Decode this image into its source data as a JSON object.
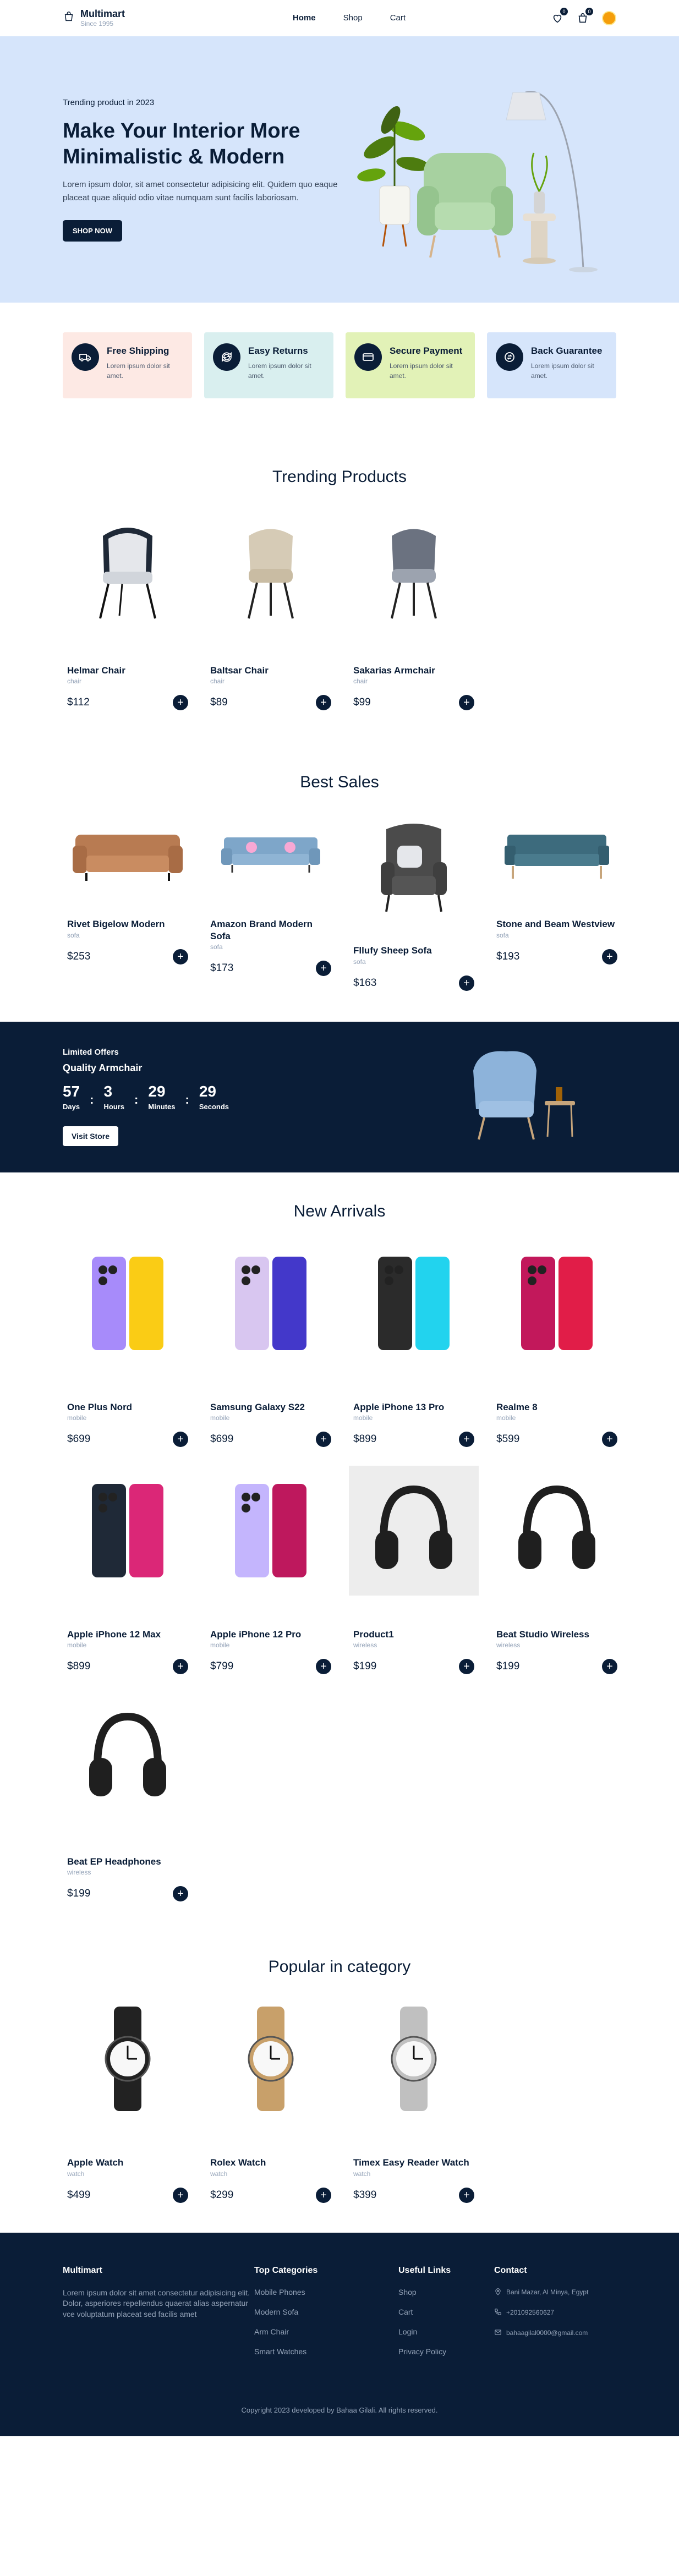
{
  "nav": {
    "brand": "Multimart",
    "since": "Since 1995",
    "links": [
      "Home",
      "Shop",
      "Cart"
    ],
    "wishlist_count": "0",
    "cart_count": "0"
  },
  "hero": {
    "tag": "Trending product in 2023",
    "title": "Make Your Interior More Minimalistic & Modern",
    "desc": "Lorem ipsum dolor, sit amet consectetur adipisicing elit. Quidem quo eaque placeat quae aliquid odio vitae numquam sunt facilis laboriosam.",
    "button": "SHOP NOW"
  },
  "services": [
    {
      "title": "Free Shipping",
      "desc": "Lorem ipsum dolor sit amet.",
      "bg": "#fde9e4",
      "icon": "truck-icon"
    },
    {
      "title": "Easy Returns",
      "desc": "Lorem ipsum dolor sit amet.",
      "bg": "#d9efef",
      "icon": "refresh-icon"
    },
    {
      "title": "Secure Payment",
      "desc": "Lorem ipsum dolor sit amet.",
      "bg": "#e2f2b7",
      "icon": "card-icon"
    },
    {
      "title": "Back Guarantee",
      "desc": "Lorem ipsum dolor sit amet.",
      "bg": "#d6e5fb",
      "icon": "exchange-icon"
    }
  ],
  "trending": {
    "title": "Trending Products",
    "items": [
      {
        "name": "Helmar Chair",
        "cat": "chair",
        "price": "$112",
        "img": "chair-icon"
      },
      {
        "name": "Baltsar Chair",
        "cat": "chair",
        "price": "$89",
        "img": "chair-icon"
      },
      {
        "name": "Sakarias Armchair",
        "cat": "chair",
        "price": "$99",
        "img": "chair-icon"
      }
    ]
  },
  "best": {
    "title": "Best Sales",
    "items": [
      {
        "name": "Rivet Bigelow Modern",
        "cat": "sofa",
        "price": "$253",
        "img": "sofa-icon"
      },
      {
        "name": "Amazon Brand Modern Sofa",
        "cat": "sofa",
        "price": "$173",
        "img": "sofa-icon"
      },
      {
        "name": "Fllufy Sheep Sofa",
        "cat": "sofa",
        "price": "$163",
        "img": "sofa-icon"
      },
      {
        "name": "Stone and Beam Westview",
        "cat": "sofa",
        "price": "$193",
        "img": "sofa-icon"
      }
    ]
  },
  "timer": {
    "label": "Limited Offers",
    "product": "Quality Armchair",
    "units": [
      {
        "num": "57",
        "lab": "Days"
      },
      {
        "num": "3",
        "lab": "Hours"
      },
      {
        "num": "29",
        "lab": "Minutes"
      },
      {
        "num": "29",
        "lab": "Seconds"
      }
    ],
    "button": "Visit Store"
  },
  "arrivals": {
    "title": "New Arrivals",
    "items": [
      {
        "name": "One Plus Nord",
        "cat": "mobile",
        "price": "$699",
        "img": "phone-icon"
      },
      {
        "name": "Samsung Galaxy S22",
        "cat": "mobile",
        "price": "$699",
        "img": "phone-icon"
      },
      {
        "name": "Apple iPhone 13 Pro",
        "cat": "mobile",
        "price": "$899",
        "img": "phone-icon"
      },
      {
        "name": "Realme 8",
        "cat": "mobile",
        "price": "$599",
        "img": "phone-icon"
      },
      {
        "name": "Apple iPhone 12 Max",
        "cat": "mobile",
        "price": "$899",
        "img": "phone-icon"
      },
      {
        "name": "Apple iPhone 12 Pro",
        "cat": "mobile",
        "price": "$799",
        "img": "phone-icon"
      },
      {
        "name": "Product1",
        "cat": "wireless",
        "price": "$199",
        "img": "headphones-icon"
      },
      {
        "name": "Beat Studio Wireless",
        "cat": "wireless",
        "price": "$199",
        "img": "headphones-icon"
      },
      {
        "name": "Beat EP Headphones",
        "cat": "wireless",
        "price": "$199",
        "img": "headphones-icon"
      }
    ]
  },
  "popular": {
    "title": "Popular in category",
    "items": [
      {
        "name": "Apple Watch",
        "cat": "watch",
        "price": "$499",
        "img": "watch-icon"
      },
      {
        "name": "Rolex Watch",
        "cat": "watch",
        "price": "$299",
        "img": "watch-icon"
      },
      {
        "name": "Timex Easy Reader Watch",
        "cat": "watch",
        "price": "$399",
        "img": "watch-icon"
      }
    ]
  },
  "footer": {
    "brand": "Multimart",
    "desc": "Lorem ipsum dolor sit amet consectetur adipisicing elit. Dolor, asperiores repellendus quaerat alias aspernatur vce voluptatum placeat sed facilis amet",
    "cat_title": "Top Categories",
    "categories": [
      "Mobile Phones",
      "Modern Sofa",
      "Arm Chair",
      "Smart Watches"
    ],
    "links_title": "Useful Links",
    "links": [
      "Shop",
      "Cart",
      "Login",
      "Privacy Policy"
    ],
    "contact_title": "Contact",
    "contact": [
      "Bani Mazar, Al Minya, Egypt",
      "+201092560627",
      "bahaagilal0000@gmail.com"
    ],
    "copyright": "Copyright 2023 developed by Bahaa Gilali. All rights reserved."
  },
  "colors": {
    "primary": "#0a1d37",
    "hero_bg": "#d6e5fb"
  }
}
